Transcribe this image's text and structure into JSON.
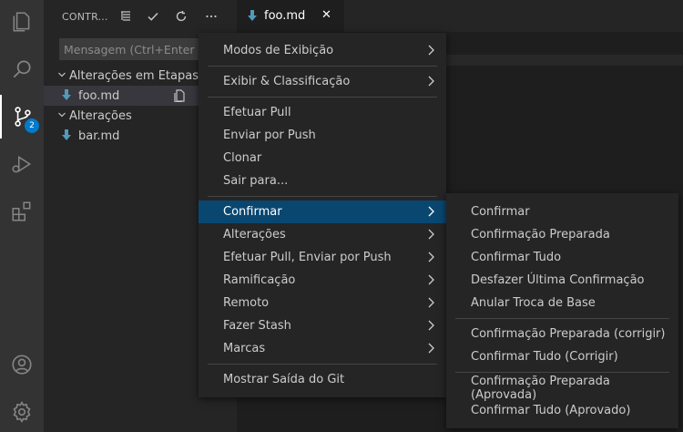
{
  "sidebar": {
    "title": "CONTR...",
    "commit_placeholder": "Mensagem (Ctrl+Enter para",
    "staged_group": "Alterações em Etapas",
    "staged_file": "foo.md",
    "changes_group": "Alterações",
    "changes_file": "bar.md",
    "badge_count": "2"
  },
  "tabs": [
    {
      "label": "foo.md",
      "close": "✕"
    }
  ],
  "menu": {
    "items": [
      {
        "label": "Modos de Exibição"
      },
      {
        "label": "Exibir & Classificação"
      },
      {
        "label": "Efetuar Pull"
      },
      {
        "label": "Enviar por Push"
      },
      {
        "label": "Clonar"
      },
      {
        "label": "Sair para..."
      },
      {
        "label": "Confirmar"
      },
      {
        "label": "Alterações"
      },
      {
        "label": "Efetuar Pull, Enviar por Push"
      },
      {
        "label": "Ramificação"
      },
      {
        "label": "Remoto"
      },
      {
        "label": "Fazer Stash"
      },
      {
        "label": "Marcas"
      },
      {
        "label": "Mostrar Saída do Git"
      }
    ]
  },
  "submenu": {
    "items": [
      {
        "label": "Confirmar"
      },
      {
        "label": "Confirmação Preparada"
      },
      {
        "label": "Confirmar Tudo"
      },
      {
        "label": "Desfazer Última Confirmação"
      },
      {
        "label": "Anular Troca de Base"
      },
      {
        "label": "Confirmação Preparada (corrigir)"
      },
      {
        "label": "Confirmar Tudo (Corrigir)"
      },
      {
        "label": "Confirmação Preparada (Aprovada)"
      },
      {
        "label": "Confirmar Tudo (Aprovado)"
      }
    ]
  },
  "colors": {
    "accent": "#007acc",
    "menu_highlight": "#094771",
    "markdown_icon": "#519aba"
  }
}
